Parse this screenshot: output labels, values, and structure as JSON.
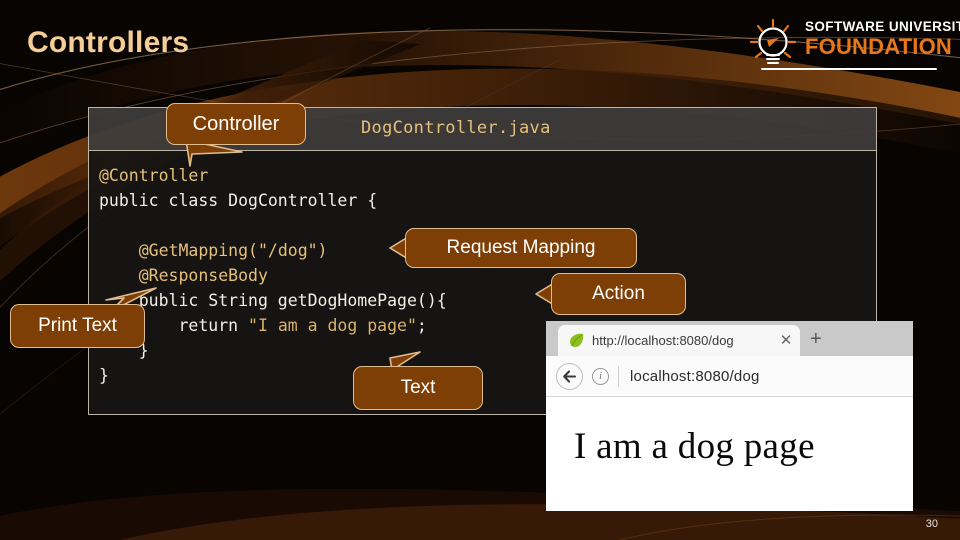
{
  "slide": {
    "title": "Controllers",
    "number": "30",
    "accent_color": "#7E3F06",
    "callout_border_color": "#E0BC8E",
    "title_color": "#F6CE95",
    "background_color": "#070402"
  },
  "logo": {
    "line1": "SOFTWARE UNIVERSITY",
    "line2": "FOUNDATION",
    "icon": "lightbulb-icon",
    "line2_color": "#E8761A"
  },
  "code_panel": {
    "filename": "DogController.java",
    "lines": [
      {
        "segments": [
          {
            "text": "@Controller",
            "style": "anno"
          }
        ]
      },
      {
        "segments": [
          {
            "text": "public class DogController {",
            "style": "plain"
          }
        ]
      },
      {
        "segments": [
          {
            "text": "",
            "style": "plain"
          }
        ]
      },
      {
        "segments": [
          {
            "text": "    ",
            "style": "plain"
          },
          {
            "text": "@GetMapping(\"/dog\")",
            "style": "anno"
          }
        ]
      },
      {
        "segments": [
          {
            "text": "    ",
            "style": "plain"
          },
          {
            "text": "@ResponseBody",
            "style": "anno"
          }
        ]
      },
      {
        "segments": [
          {
            "text": "    public String getDogHomePage(){",
            "style": "plain"
          }
        ]
      },
      {
        "segments": [
          {
            "text": "        return ",
            "style": "plain"
          },
          {
            "text": "\"I am a dog page\"",
            "style": "str"
          },
          {
            "text": ";",
            "style": "plain"
          }
        ]
      },
      {
        "segments": [
          {
            "text": "    }",
            "style": "plain"
          }
        ]
      },
      {
        "segments": [
          {
            "text": "}",
            "style": "plain"
          }
        ]
      }
    ]
  },
  "callouts": {
    "controller": "Controller",
    "request_mapping": "Request Mapping",
    "action": "Action",
    "print_text": "Print Text",
    "text": "Text"
  },
  "browser": {
    "tab_title": "http://localhost:8080/dog",
    "tab_favicon": "spring-leaf-icon",
    "close_label": "✕",
    "new_tab_label": "+",
    "back_label": "←",
    "info_label": "i",
    "url": "localhost:8080/dog",
    "page_text": "I am a dog page"
  }
}
